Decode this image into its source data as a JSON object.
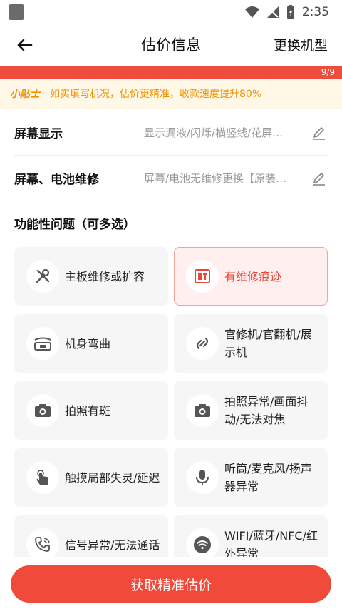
{
  "status_bar": {
    "time": "2:35"
  },
  "header": {
    "title": "估价信息",
    "change_model": "更换机型"
  },
  "progress": {
    "text": "9/9",
    "fraction": 1.0
  },
  "tip": {
    "tag": "小贴士",
    "text": "如实填写机况，估价更精准，收款速度提升80%"
  },
  "rows": [
    {
      "label": "屏幕显示",
      "value": "显示漏液/闪烁/横竖线/花屏…"
    },
    {
      "label": "屏幕、电池维修",
      "value": "屏幕/电池无维修更换【原装…"
    }
  ],
  "section_title": "功能性问题（可多选）",
  "options": [
    {
      "label": "主板维修或扩容",
      "icon": "tools-icon",
      "selected": false
    },
    {
      "label": "有维修痕迹",
      "icon": "repair-trace-icon",
      "selected": true
    },
    {
      "label": "机身弯曲",
      "icon": "bent-phone-icon",
      "selected": false
    },
    {
      "label": "官修机/官翻机/展示机",
      "icon": "link-icon",
      "selected": false
    },
    {
      "label": "拍照有斑",
      "icon": "camera-icon",
      "selected": false
    },
    {
      "label": "拍照异常/画面抖动/无法对焦",
      "icon": "camera-icon",
      "selected": false
    },
    {
      "label": "触摸局部失灵/延迟",
      "icon": "touch-icon",
      "selected": false
    },
    {
      "label": "听筒/麦克风/扬声器异常",
      "icon": "microphone-icon",
      "selected": false
    },
    {
      "label": "信号异常/无法通话",
      "icon": "phone-call-icon",
      "selected": false
    },
    {
      "label": "WIFI/蓝牙/NFC/红外异常",
      "icon": "wifi-icon",
      "selected": false
    }
  ],
  "cta": {
    "label": "获取精准估价"
  },
  "colors": {
    "accent": "#ef4a3a",
    "tip": "#f29100",
    "tip_bg": "#fff8e6"
  }
}
